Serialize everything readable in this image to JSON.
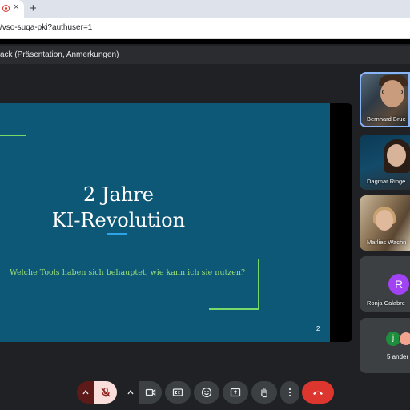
{
  "browser": {
    "tab_close": "×",
    "new_tab": "+",
    "url": "/vso-suqa-pki?authuser=1"
  },
  "presenter_bar": {
    "text": "ack (Präsentation, Anmerkungen)"
  },
  "slide": {
    "title_line1": "2 Jahre",
    "title_line2": "KI-Revolution",
    "subtitle": "Welche Tools haben sich behauptet, wie kann ich sie nutzen?",
    "page_number": "2",
    "background_color": "#0e5877",
    "accent_color": "#78d86a"
  },
  "participants": [
    {
      "name": "Bernhard Brue",
      "active_speaker": true
    },
    {
      "name": "Dagmar Ringe"
    },
    {
      "name": "Marlies Wachn"
    },
    {
      "name": "Ronja Calabre",
      "avatar_letter": "R",
      "avatar_color": "#a142f4"
    },
    {
      "name": "5 ander",
      "avatar_letter": "j",
      "avatar_color": "#1e8e3e"
    }
  ],
  "controls": {
    "mic_options_icon": "chevron-up-icon",
    "mic_icon": "mic-off-icon",
    "mic_muted": true,
    "camera_options_icon": "chevron-up-icon",
    "camera_icon": "videocam-icon",
    "captions_icon": "closed-captions-icon",
    "emoji_icon": "emoji-icon",
    "present_icon": "present-screen-icon",
    "hand_icon": "raise-hand-icon",
    "more_icon": "more-vert-icon",
    "end_call_icon": "call-end-icon",
    "end_call_color": "#dc362e"
  }
}
